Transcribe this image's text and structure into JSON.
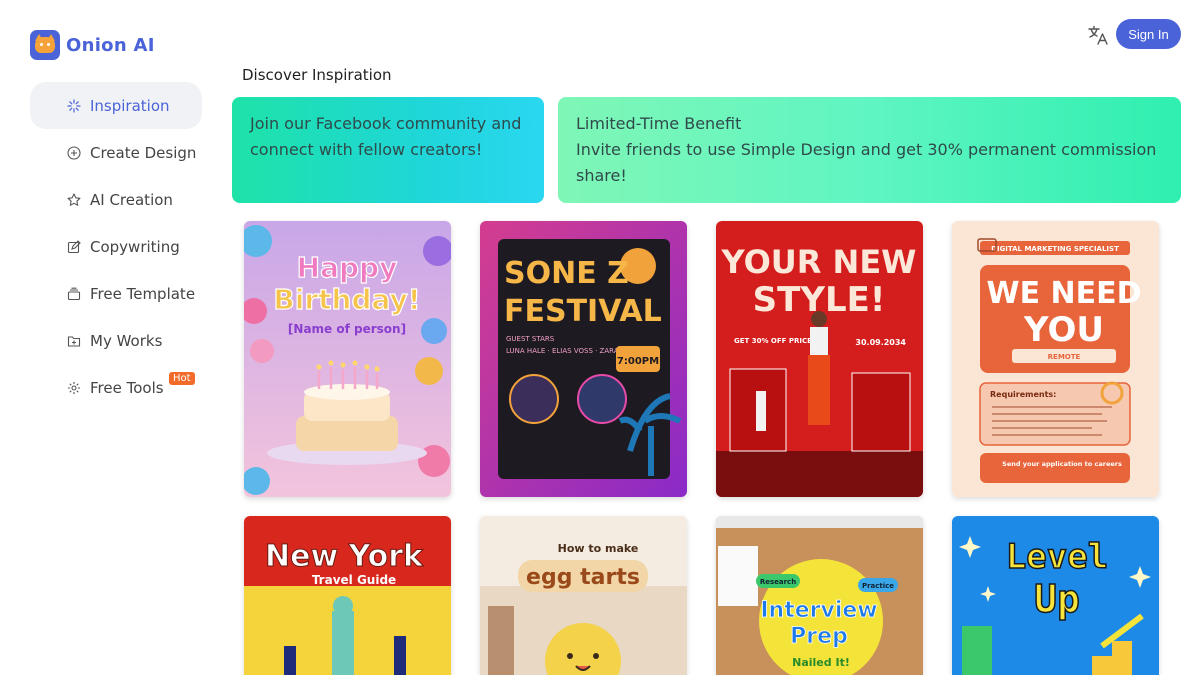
{
  "brand": {
    "name": "Onion AI",
    "logo_icon": "onion-cat-logo-icon",
    "accent": "#4a63d8"
  },
  "header": {
    "sign_in_label": "Sign In",
    "translate_icon": "translate-icon"
  },
  "sidebar": {
    "items": [
      {
        "label": "Inspiration",
        "icon": "sparkle-icon",
        "active": true
      },
      {
        "label": "Create Design",
        "icon": "plus-circle-icon"
      },
      {
        "label": "AI Creation",
        "icon": "star-icon"
      },
      {
        "label": "Copywriting",
        "icon": "edit-icon"
      },
      {
        "label": "Free Template",
        "icon": "template-icon"
      },
      {
        "label": "My Works",
        "icon": "folder-icon"
      },
      {
        "label": "Free Tools",
        "icon": "gear-icon",
        "badge": "Hot"
      }
    ]
  },
  "main": {
    "title": "Discover Inspiration",
    "banners": [
      {
        "text": "Join our Facebook community and connect with fellow creators!"
      },
      {
        "line1": "Limited-Time Benefit",
        "line2": "Invite friends to use Simple Design and get 30% permanent commission share!"
      }
    ],
    "templates": [
      {
        "line1": "Happy",
        "line2": "Birthday!",
        "line3": "[Name of person]"
      },
      {
        "line1": "SONE Z",
        "line2": "FESTIVAL",
        "guest_title": "GUEST STARS",
        "guests": "LUNA HALE · ELIAS VOSS · ZARA KANE",
        "time": "7:00PM"
      },
      {
        "line1": "YOUR NEW",
        "line2": "STYLE!",
        "promo": "GET 30% OFF PRICE!",
        "date": "30.09.2034"
      },
      {
        "header": "DIGITAL MARKETING SPECIALIST",
        "line1": "WE NEED",
        "line2": "YOU",
        "tag": "REMOTE",
        "req": "Requirements:",
        "footer": "Send your application to careers"
      },
      {
        "line1": "New York",
        "line2": "Travel Guide"
      },
      {
        "line1": "How to make",
        "line2": "egg tarts"
      },
      {
        "tag1": "Research",
        "tag2": "Practice",
        "line1": "Interview",
        "line2": "Prep",
        "line3": "Nailed It!"
      },
      {
        "line1": "Level",
        "line2": "Up"
      }
    ]
  }
}
